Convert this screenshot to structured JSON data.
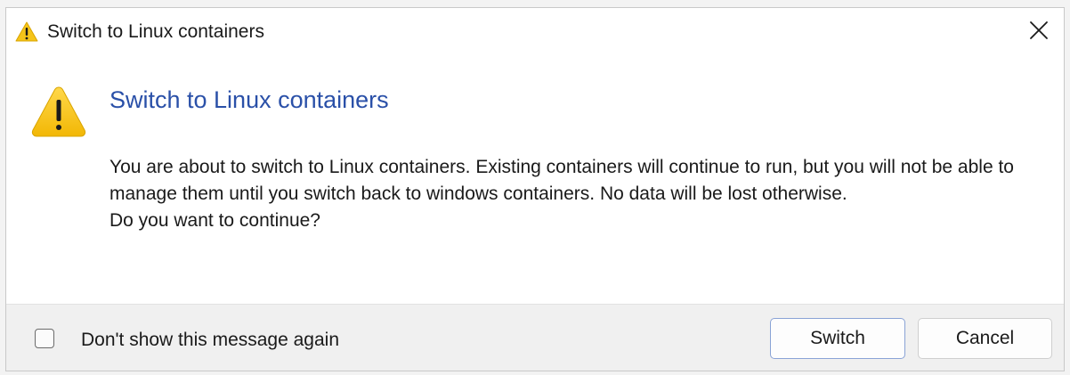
{
  "window": {
    "title": "Switch to Linux containers"
  },
  "dialog": {
    "heading": "Switch to Linux containers",
    "message_line1": "You are about to switch to Linux containers. Existing containers will continue to run, but you will not be able to manage them until you switch back to windows containers. No data will be lost otherwise.",
    "message_line2": "Do you want to continue?"
  },
  "footer": {
    "checkbox_label": "Don't show this message again",
    "checkbox_checked": false,
    "switch_label": "Switch",
    "cancel_label": "Cancel"
  },
  "icons": {
    "title": "warning-icon",
    "main": "warning-icon",
    "close": "close-icon"
  },
  "colors": {
    "heading": "#2a50a8",
    "warning_fill": "#f5c419",
    "primary_button_border": "#8aa3d6"
  }
}
